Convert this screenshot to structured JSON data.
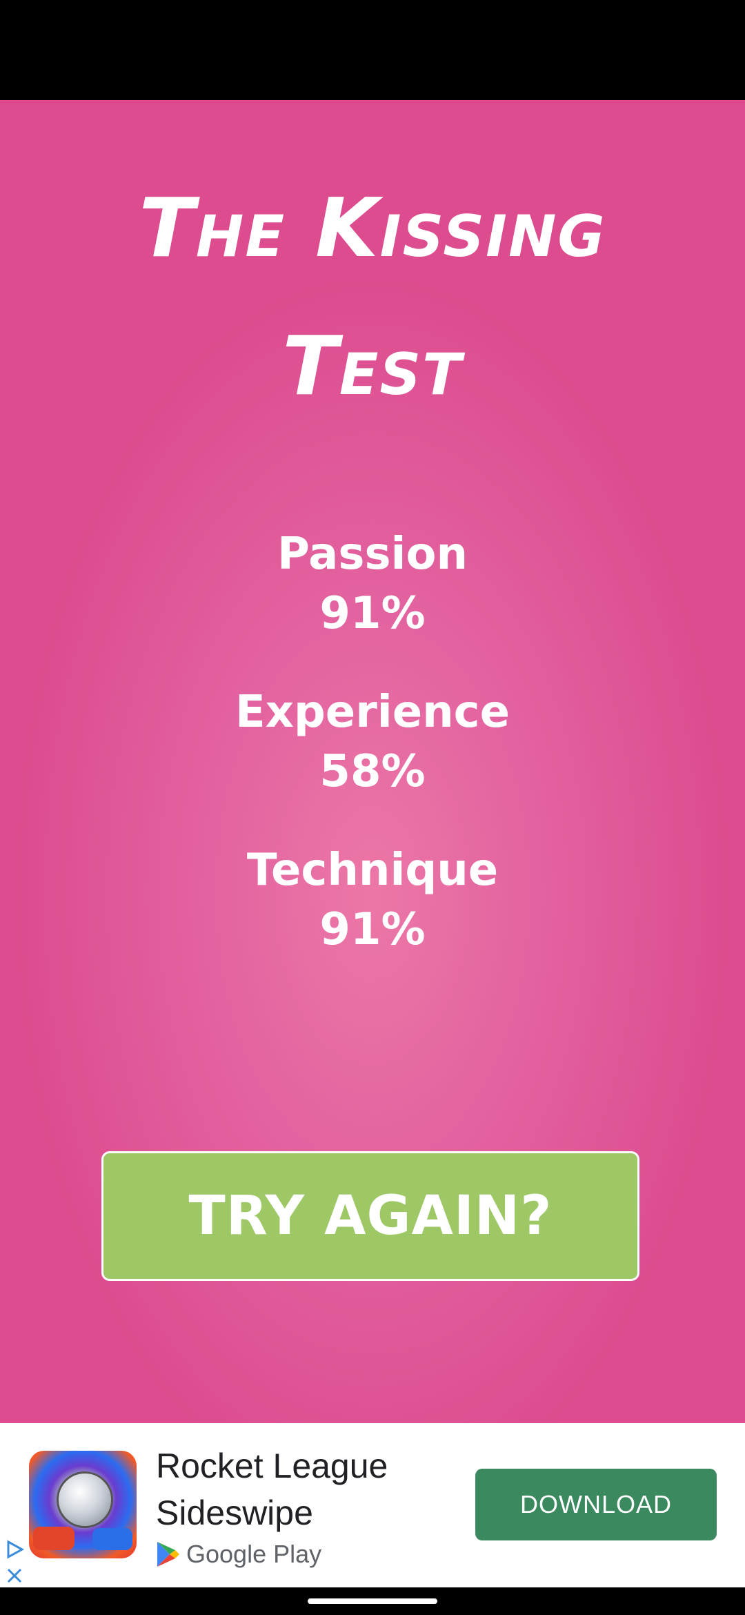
{
  "app": {
    "title_line1": "The Kissing",
    "title_line2": "Test"
  },
  "results": [
    {
      "label": "Passion",
      "value": "91%"
    },
    {
      "label": "Experience",
      "value": "58%"
    },
    {
      "label": "Technique",
      "value": "91%"
    }
  ],
  "actions": {
    "try_again_label": "TRY AGAIN?"
  },
  "ad": {
    "title": "Rocket League Sideswipe",
    "store": "Google Play",
    "cta": "DOWNLOAD"
  },
  "colors": {
    "background": "#dc4c8e",
    "button": "#9ec866",
    "ad_cta": "#3b8a5f"
  }
}
